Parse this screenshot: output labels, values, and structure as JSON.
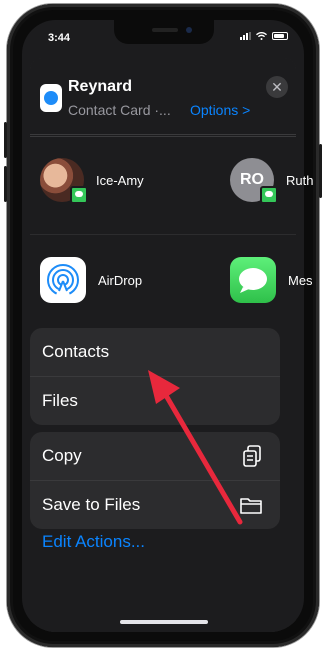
{
  "status_bar": {
    "time": "3:44"
  },
  "share_sheet": {
    "title": "Reynard",
    "subtitle": "Contact Card ·...",
    "options_label": "Options >",
    "close_label": "✕"
  },
  "people": [
    {
      "name": "Ice-Amy"
    },
    {
      "name": "Ruth",
      "initials": "RO"
    }
  ],
  "apps": [
    {
      "name": "AirDrop"
    },
    {
      "name": "Mes"
    }
  ],
  "group1": [
    {
      "label": "Contacts"
    },
    {
      "label": "Files"
    }
  ],
  "group2": [
    {
      "label": "Copy",
      "icon": "copy-icon"
    },
    {
      "label": "Save to Files",
      "icon": "folder-icon"
    }
  ],
  "edit_actions_label": "Edit Actions...",
  "colors": {
    "accent": "#0a84ff",
    "sheet": "#1c1c1e",
    "cell": "#2c2c2e",
    "arrow": "#e8283c"
  }
}
